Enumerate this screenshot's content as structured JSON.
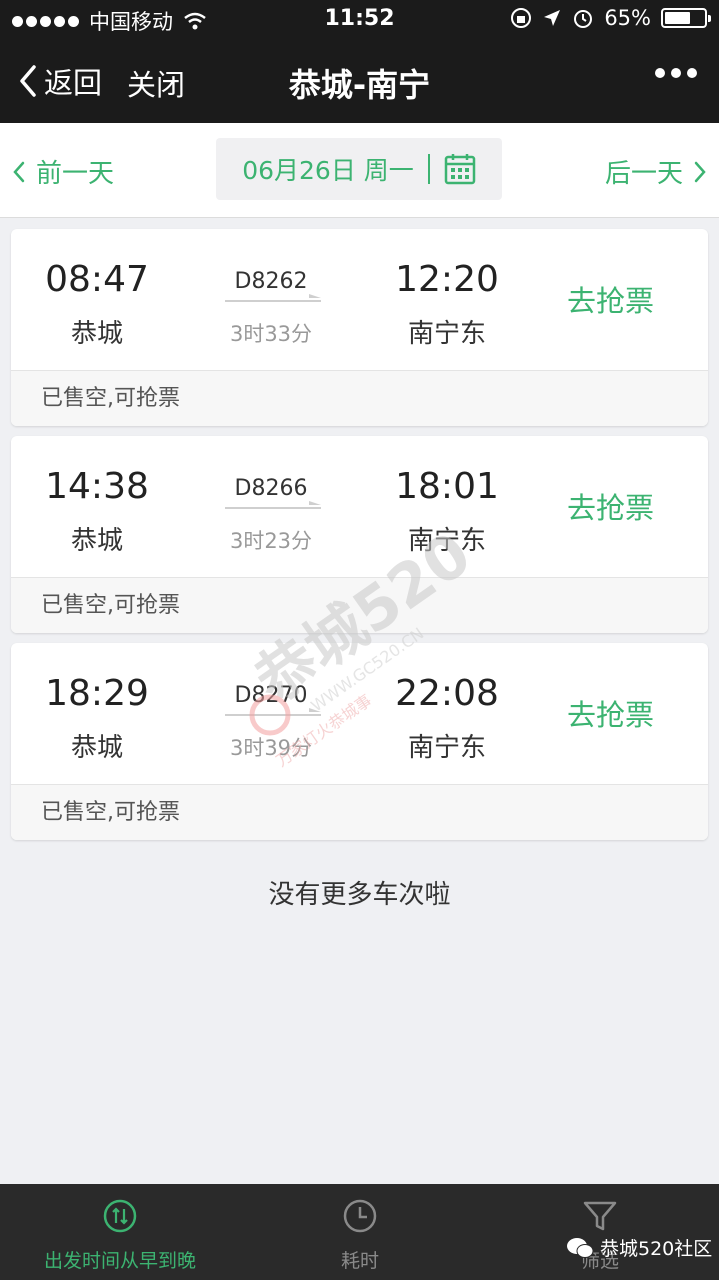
{
  "status_bar": {
    "carrier": "中国移动",
    "time": "11:52",
    "battery": "65%",
    "battery_level": 0.65
  },
  "nav": {
    "back_label": "返回",
    "close_label": "关闭",
    "title": "恭城-南宁"
  },
  "date_bar": {
    "prev_label": "前一天",
    "date_label": "06月26日 周一",
    "next_label": "后一天"
  },
  "trains": [
    {
      "dep_time": "08:47",
      "dep_station": "恭城",
      "train_no": "D8262",
      "duration": "3时33分",
      "arr_time": "12:20",
      "arr_station": "南宁东",
      "action": "去抢票",
      "status": "已售空,可抢票"
    },
    {
      "dep_time": "14:38",
      "dep_station": "恭城",
      "train_no": "D8266",
      "duration": "3时23分",
      "arr_time": "18:01",
      "arr_station": "南宁东",
      "action": "去抢票",
      "status": "已售空,可抢票"
    },
    {
      "dep_time": "18:29",
      "dep_station": "恭城",
      "train_no": "D8270",
      "duration": "3时39分",
      "arr_time": "22:08",
      "arr_station": "南宁东",
      "action": "去抢票",
      "status": "已售空,可抢票"
    }
  ],
  "no_more": "没有更多车次啦",
  "bottom_tabs": [
    {
      "label": "出发时间从早到晚",
      "icon": "sort-icon",
      "active": true
    },
    {
      "label": "耗时",
      "icon": "clock-icon",
      "active": false
    },
    {
      "label": "筛选",
      "icon": "filter-icon",
      "active": false
    }
  ],
  "watermark": {
    "text": "恭城520",
    "url": "WWW.GC520.CN",
    "slogan": "万家灯火恭城事"
  },
  "badge_text": "恭城520社区",
  "colors": {
    "accent": "#3cb371",
    "nav_bg": "#1b1b1b",
    "page_bg": "#eff0f3"
  }
}
